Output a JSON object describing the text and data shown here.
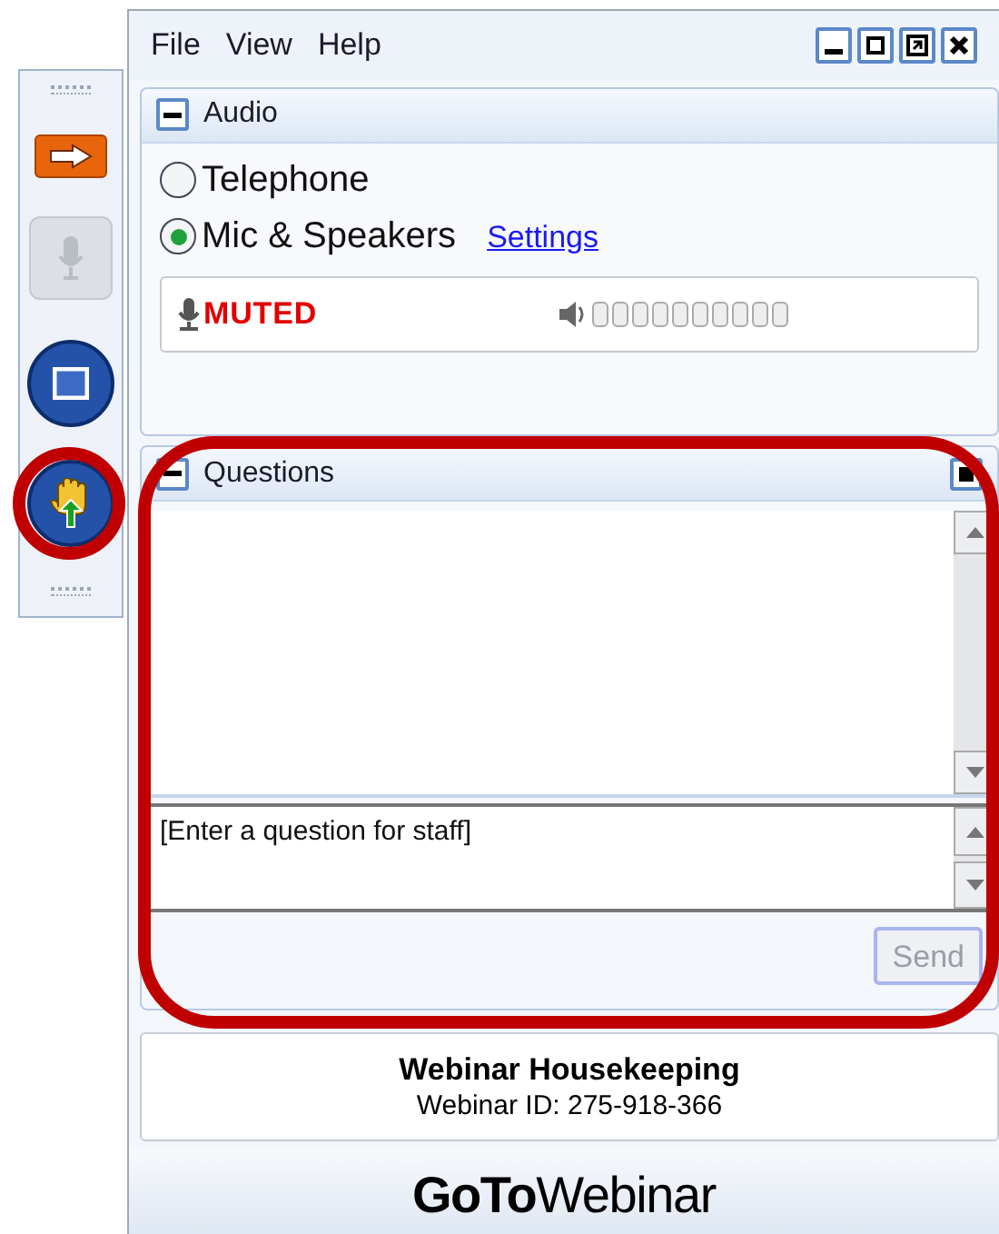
{
  "toolbar": [
    {
      "kind": "arrow",
      "disabled": false
    },
    {
      "kind": "mic",
      "disabled": true
    },
    {
      "kind": "screen",
      "disabled": false
    },
    {
      "kind": "hand",
      "disabled": false
    }
  ],
  "menu": [
    "File",
    "View",
    "Help"
  ],
  "audio": {
    "title": "Audio",
    "expanded": true,
    "options": [
      {
        "label": "Telephone",
        "selected": false
      },
      {
        "label": "Mic & Speakers",
        "selected": true
      }
    ],
    "settings_link": "Settings",
    "mic_status": "MUTED"
  },
  "questions": {
    "title": "Questions",
    "placeholder": "[Enter a question for staff]",
    "send": "Send",
    "send_disabled": true
  },
  "webinar": {
    "title": "Webinar Housekeeping",
    "id": "Webinar ID: 275-918-366"
  },
  "logo": "**GoTo**Webinar"
}
